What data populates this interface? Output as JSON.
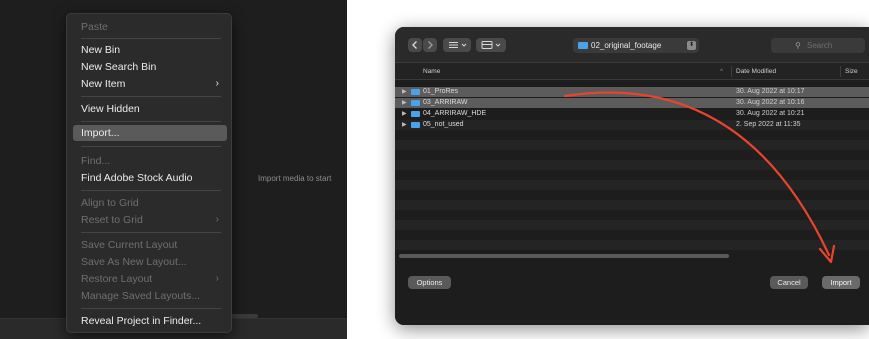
{
  "context_menu": {
    "items": [
      {
        "label": "Paste",
        "enabled": false
      },
      {
        "label": "New Bin",
        "enabled": true
      },
      {
        "label": "New Search Bin",
        "enabled": true
      },
      {
        "label": "New Item",
        "enabled": true,
        "submenu": true
      },
      {
        "label": "View Hidden",
        "enabled": true
      },
      {
        "label": "Import...",
        "enabled": true,
        "highlighted": true
      },
      {
        "label": "Find...",
        "enabled": false
      },
      {
        "label": "Find Adobe Stock Audio",
        "enabled": true
      },
      {
        "label": "Align to Grid",
        "enabled": false
      },
      {
        "label": "Reset to Grid",
        "enabled": false,
        "submenu": true
      },
      {
        "label": "Save Current Layout",
        "enabled": false
      },
      {
        "label": "Save As New Layout...",
        "enabled": false
      },
      {
        "label": "Restore Layout",
        "enabled": false,
        "submenu": true
      },
      {
        "label": "Manage Saved Layouts...",
        "enabled": false
      },
      {
        "label": "Reveal Project in Finder...",
        "enabled": true
      }
    ],
    "submenu_glyph": "›"
  },
  "empty_hint": "Import media to start",
  "dialog": {
    "current_folder": "02_original_footage",
    "search_placeholder": "Search",
    "columns": {
      "name": "Name",
      "date": "Date Modified",
      "size": "Size"
    },
    "sort_glyph": "^",
    "rows": [
      {
        "name": "01_ProRes",
        "date": "30. Aug 2022 at 10:17",
        "selected": true
      },
      {
        "name": "03_ARRIRAW",
        "date": "30. Aug 2022 at 10:16",
        "selected": true
      },
      {
        "name": "04_ARRIRAW_HDE",
        "date": "30. Aug 2022 at 10:21",
        "selected": false
      },
      {
        "name": "05_not_used",
        "date": "2. Sep 2022 at 11:35",
        "selected": false
      }
    ],
    "options_label": "Options",
    "cancel_label": "Cancel",
    "import_label": "Import"
  },
  "toolbar_icons": [
    "back-icon",
    "forward-icon",
    "list-view-icon",
    "group-icon"
  ],
  "colors": {
    "folder_blue": "#4aa3e8",
    "arrow_red": "#e8452c",
    "selection": "#5c5c5c"
  }
}
